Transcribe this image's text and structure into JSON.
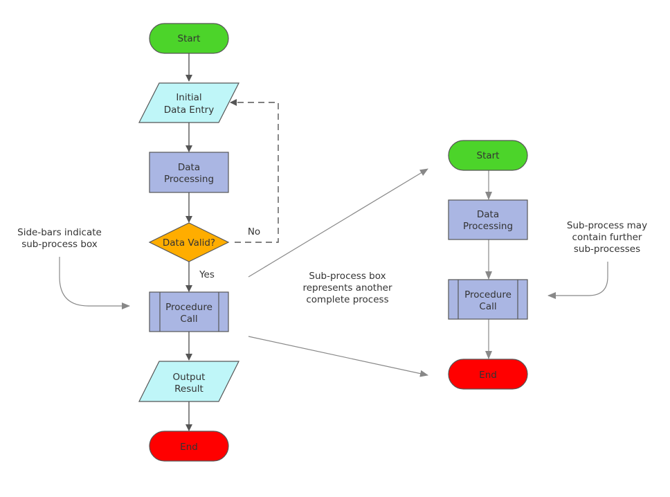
{
  "colors": {
    "start": "#4cd42a",
    "end": "#ff0000",
    "io": "#bff6f8",
    "process": "#aab6e3",
    "decision": "#ffad00",
    "stroke": "#555555",
    "annotation_line": "#888888"
  },
  "main_flow": {
    "start": "Start",
    "input_line1": "Initial",
    "input_line2": "Data Entry",
    "process_line1": "Data",
    "process_line2": "Processing",
    "decision": "Data Valid?",
    "no_label": "No",
    "yes_label": "Yes",
    "subprocess_line1": "Procedure",
    "subprocess_line2": "Call",
    "output_line1": "Output",
    "output_line2": "Result",
    "end": "End"
  },
  "sub_flow": {
    "start": "Start",
    "process_line1": "Data",
    "process_line2": "Processing",
    "subprocess_line1": "Procedure",
    "subprocess_line2": "Call",
    "end": "End"
  },
  "annotations": {
    "sidebars_line1": "Side-bars indicate",
    "sidebars_line2": "sub-process box",
    "middle_line1": "Sub-process box",
    "middle_line2": "represents another",
    "middle_line3": "complete process",
    "right_line1": "Sub-process may",
    "right_line2": "contain further",
    "right_line3": "sub-processes"
  }
}
